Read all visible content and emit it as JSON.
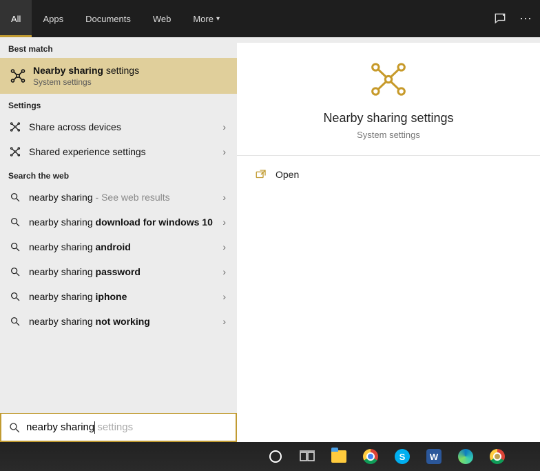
{
  "header": {
    "tabs": [
      {
        "label": "All",
        "active": true
      },
      {
        "label": "Apps",
        "active": false
      },
      {
        "label": "Documents",
        "active": false
      },
      {
        "label": "Web",
        "active": false
      },
      {
        "label": "More",
        "active": false,
        "dropdown": true
      }
    ]
  },
  "left": {
    "sections": {
      "best_match": {
        "header": "Best match",
        "item": {
          "title_prefix": "Nearby sharing",
          "title_suffix": " settings",
          "subtitle": "System settings"
        }
      },
      "settings": {
        "header": "Settings",
        "items": [
          {
            "label": "Share across devices"
          },
          {
            "label": "Shared experience settings"
          }
        ]
      },
      "web": {
        "header": "Search the web",
        "items": [
          {
            "prefix": "nearby sharing",
            "bold": "",
            "suffix": " - See web results",
            "suffix_dim": true
          },
          {
            "prefix": "nearby sharing ",
            "bold": "download for windows 10"
          },
          {
            "prefix": "nearby sharing ",
            "bold": "android"
          },
          {
            "prefix": "nearby sharing ",
            "bold": "password"
          },
          {
            "prefix": "nearby sharing ",
            "bold": "iphone"
          },
          {
            "prefix": "nearby sharing ",
            "bold": "not working"
          }
        ]
      }
    }
  },
  "preview": {
    "title": "Nearby sharing settings",
    "subtitle": "System settings",
    "actions": [
      {
        "label": "Open"
      }
    ]
  },
  "search": {
    "value": "nearby sharing",
    "suggestion_suffix": " settings"
  },
  "taskbar": {
    "items": [
      "cortana",
      "taskview",
      "explorer",
      "chrome",
      "skype",
      "word",
      "edge",
      "chrome-profile"
    ]
  }
}
